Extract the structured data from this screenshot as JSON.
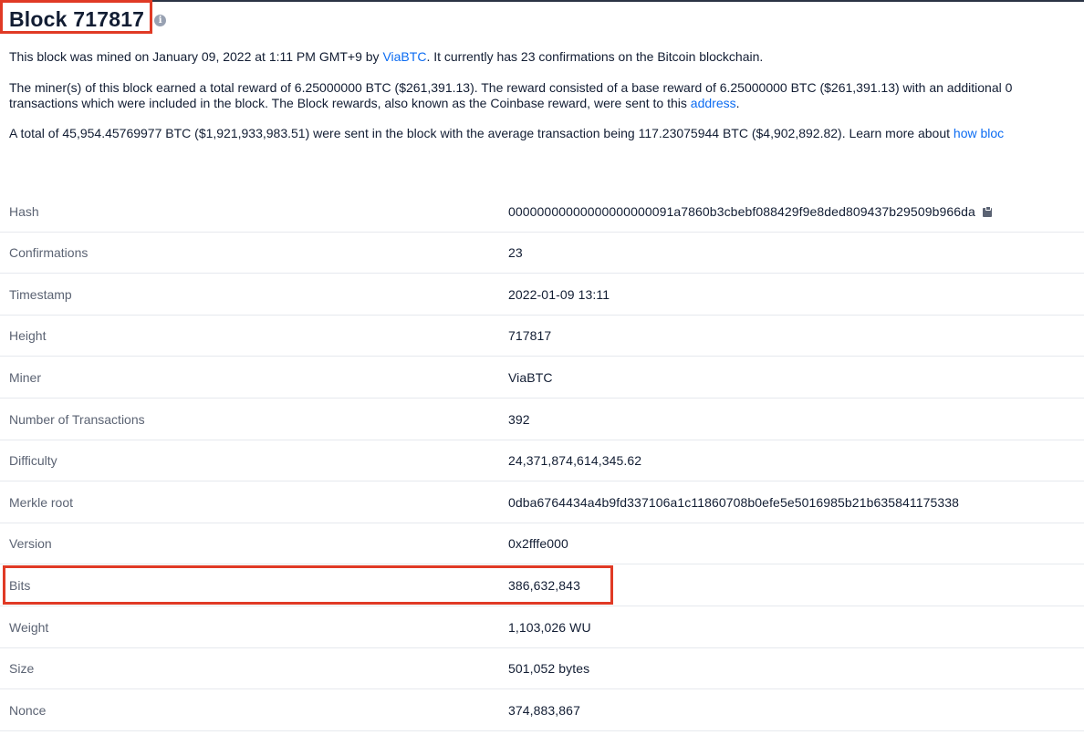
{
  "header": {
    "title": "Block 717817",
    "info_icon": "info-icon"
  },
  "summary": {
    "line1_pre": "This block was mined on January 09, 2022 at 1:11 PM GMT+9 by ",
    "line1_link": "ViaBTC",
    "line1_post": ". It currently has 23 confirmations on the Bitcoin blockchain.",
    "line2": "The miner(s) of this block earned a total reward of 6.25000000 BTC ($261,391.13). The reward consisted of a base reward of 6.25000000 BTC ($261,391.13) with an additional 0",
    "line3_pre": "transactions which were included in the block. The Block rewards, also known as the Coinbase reward, were sent to this ",
    "line3_link": "address",
    "line3_post": ".",
    "line4_pre": "A total of 45,954.45769977 BTC ($1,921,933,983.51) were sent in the block with the average transaction being 117.23075944 BTC ($4,902,892.82).  Learn more about ",
    "line4_link": "how bloc"
  },
  "details": [
    {
      "label": "Hash",
      "value": "00000000000000000000091a7860b3cbebf088429f9e8ded809437b29509b966da",
      "copy_icon": "clipboard-icon"
    },
    {
      "label": "Confirmations",
      "value": "23"
    },
    {
      "label": "Timestamp",
      "value": "2022-01-09 13:11"
    },
    {
      "label": "Height",
      "value": "717817"
    },
    {
      "label": "Miner",
      "value": "ViaBTC",
      "link": true
    },
    {
      "label": "Number of Transactions",
      "value": "392"
    },
    {
      "label": "Difficulty",
      "value": "24,371,874,614,345.62"
    },
    {
      "label": "Merkle root",
      "value": "0dba6764434a4b9fd337106a1c11860708b0efe5e5016985b21b635841175338"
    },
    {
      "label": "Version",
      "value": "0x2fffe000"
    },
    {
      "label": "Bits",
      "value": "386,632,843"
    },
    {
      "label": "Weight",
      "value": "1,103,026 WU"
    },
    {
      "label": "Size",
      "value": "501,052 bytes"
    },
    {
      "label": "Nonce",
      "value": "374,883,867"
    }
  ],
  "colors": {
    "highlight": "#e03a25",
    "link": "#0c6cf2",
    "label": "#5b6373",
    "text": "#121d33"
  }
}
